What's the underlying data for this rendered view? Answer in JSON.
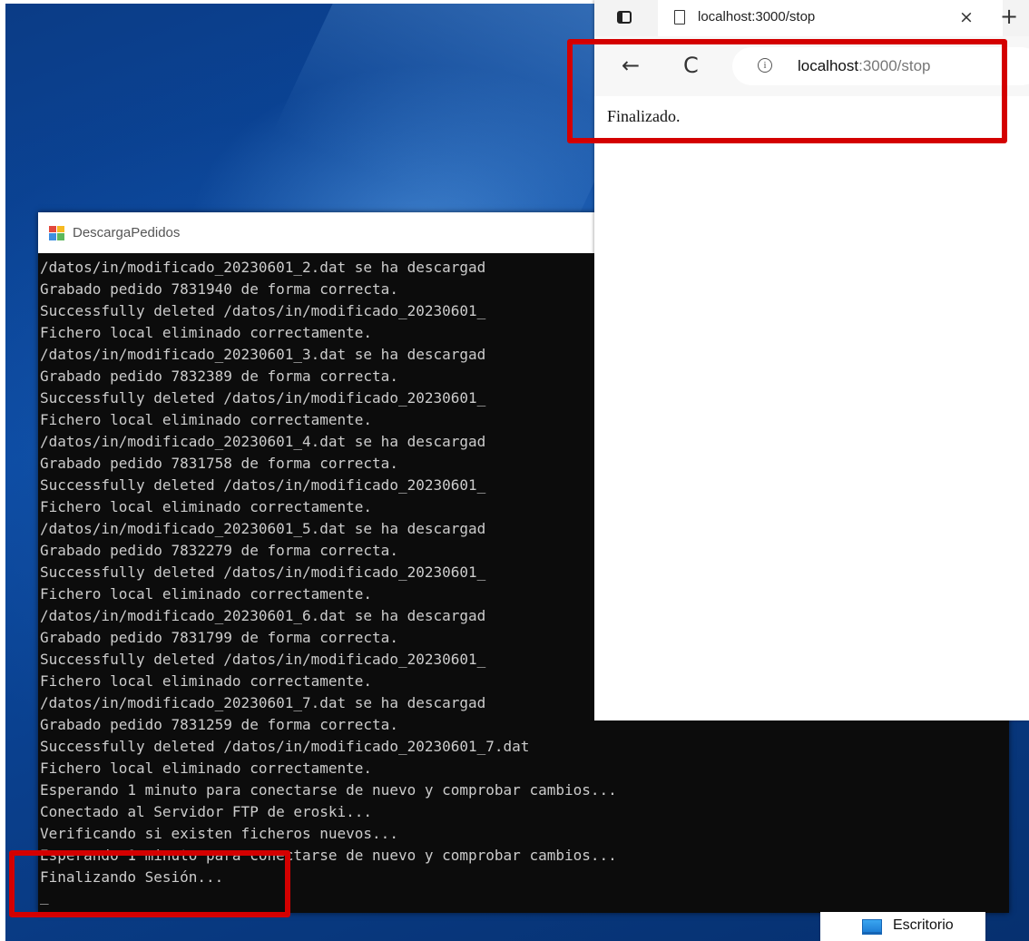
{
  "console": {
    "title": "DescargaPedidos",
    "lines": [
      "/datos/in/modificado_20230601_2.dat se ha descargad",
      "Grabado pedido 7831940 de forma correcta.",
      "Successfully deleted /datos/in/modificado_20230601_",
      "Fichero local eliminado correctamente.",
      "/datos/in/modificado_20230601_3.dat se ha descargad",
      "Grabado pedido 7832389 de forma correcta.",
      "Successfully deleted /datos/in/modificado_20230601_",
      "Fichero local eliminado correctamente.",
      "/datos/in/modificado_20230601_4.dat se ha descargad",
      "Grabado pedido 7831758 de forma correcta.",
      "Successfully deleted /datos/in/modificado_20230601_",
      "Fichero local eliminado correctamente.",
      "/datos/in/modificado_20230601_5.dat se ha descargad",
      "Grabado pedido 7832279 de forma correcta.",
      "Successfully deleted /datos/in/modificado_20230601_",
      "Fichero local eliminado correctamente.",
      "/datos/in/modificado_20230601_6.dat se ha descargad",
      "Grabado pedido 7831799 de forma correcta.",
      "Successfully deleted /datos/in/modificado_20230601_",
      "Fichero local eliminado correctamente.",
      "/datos/in/modificado_20230601_7.dat se ha descargad",
      "Grabado pedido 7831259 de forma correcta.",
      "Successfully deleted /datos/in/modificado_20230601_7.dat",
      "Fichero local eliminado correctamente.",
      "Esperando 1 minuto para conectarse de nuevo y comprobar cambios...",
      "Conectado al Servidor FTP de eroski...",
      "Verificando si existen ficheros nuevos...",
      "Esperando 1 minuto para conectarse de nuevo y comprobar cambios...",
      "Finalizando Sesión..."
    ],
    "cursor": "_"
  },
  "browser": {
    "tab_title": "localhost:3000/stop",
    "tab_close": "×",
    "new_tab": "+",
    "back": "←",
    "refresh": "C",
    "info": "i",
    "url_host": "localhost",
    "url_rest": ":3000/stop",
    "page_text": "Finalizado."
  },
  "taskbar": {
    "label": "Escritorio"
  },
  "colors": {
    "highlight": "#d40000",
    "console_bg": "#0c0c0c",
    "console_text": "#cccccc"
  },
  "icons": [
    "app-icon",
    "tab-actions-icon",
    "page-icon",
    "close-icon",
    "new-tab-icon",
    "back-icon",
    "refresh-icon",
    "info-icon",
    "desktop-icon"
  ]
}
